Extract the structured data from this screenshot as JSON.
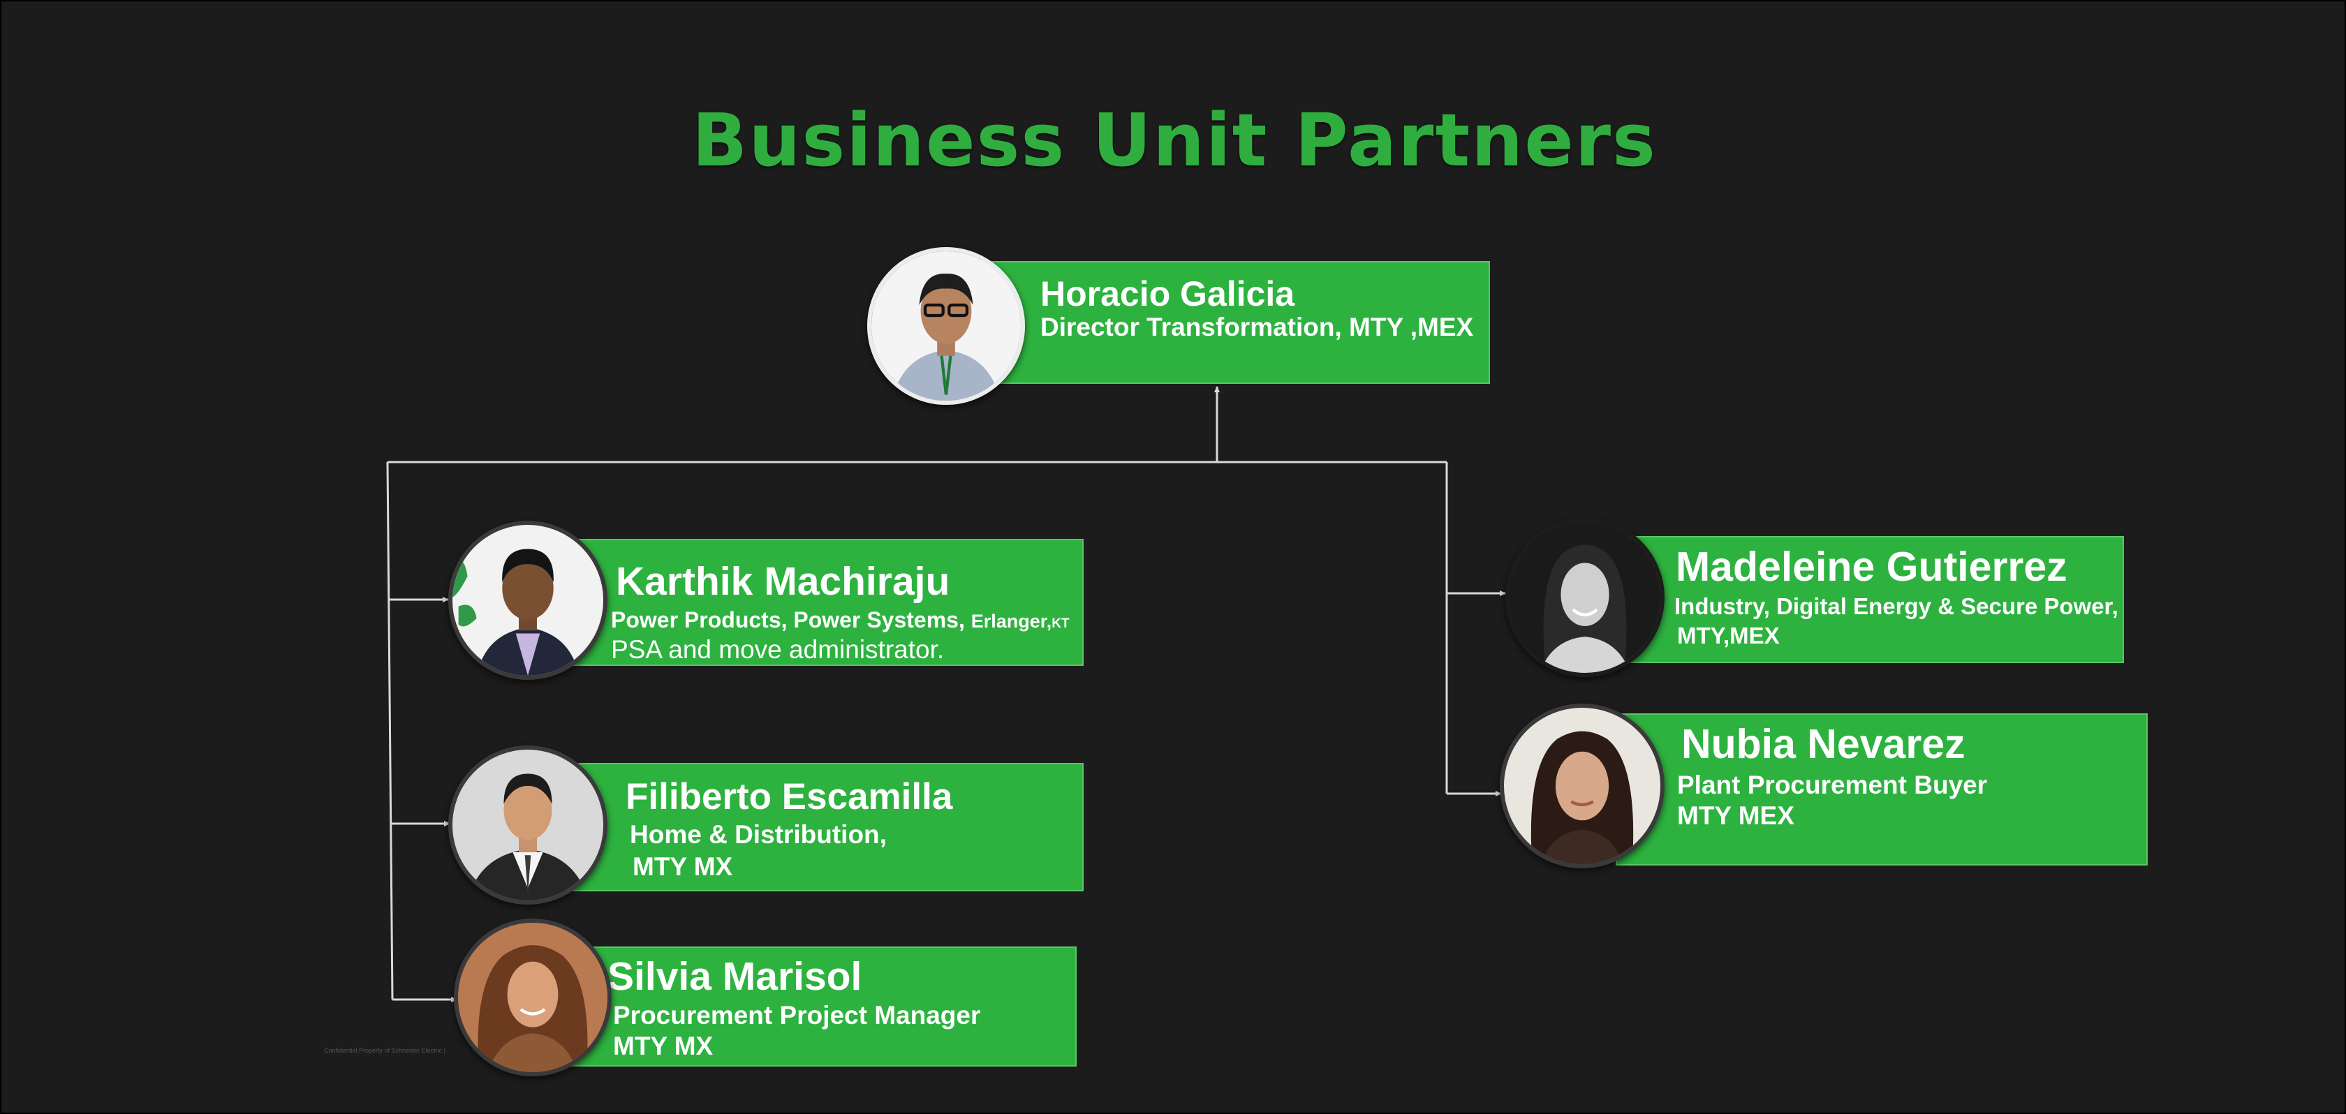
{
  "title": "Business Unit Partners",
  "root": {
    "name": "Horacio Galicia",
    "role": "Director Transformation, MTY ,MEX"
  },
  "left_column": [
    {
      "name": "Karthik Machiraju",
      "line1": "Power Products, Power Systems,",
      "line1_suffix_a": "Erlanger,",
      "line1_suffix_b": "KT",
      "line2": "PSA and move administrator."
    },
    {
      "name": "Filiberto Escamilla",
      "line1": "Home & Distribution,",
      "line2": "MTY MX"
    },
    {
      "name": "Silvia Marisol",
      "line1": "Procurement Project Manager",
      "line2": "MTY MX"
    }
  ],
  "right_column": [
    {
      "name": "Madeleine Gutierrez",
      "line1": "Industry, Digital Energy & Secure Power,",
      "line2": "MTY,MEX"
    },
    {
      "name": "Nubia Nevarez",
      "line1": "Plant Procurement Buyer",
      "line2": "MTY MEX"
    }
  ],
  "footer_note": "Confidential Property of Schneider Electric |",
  "colors": {
    "background": "#1c1c1c",
    "title": "#2fae3f",
    "box": "#2db23f",
    "connector": "#d9d9d9"
  }
}
